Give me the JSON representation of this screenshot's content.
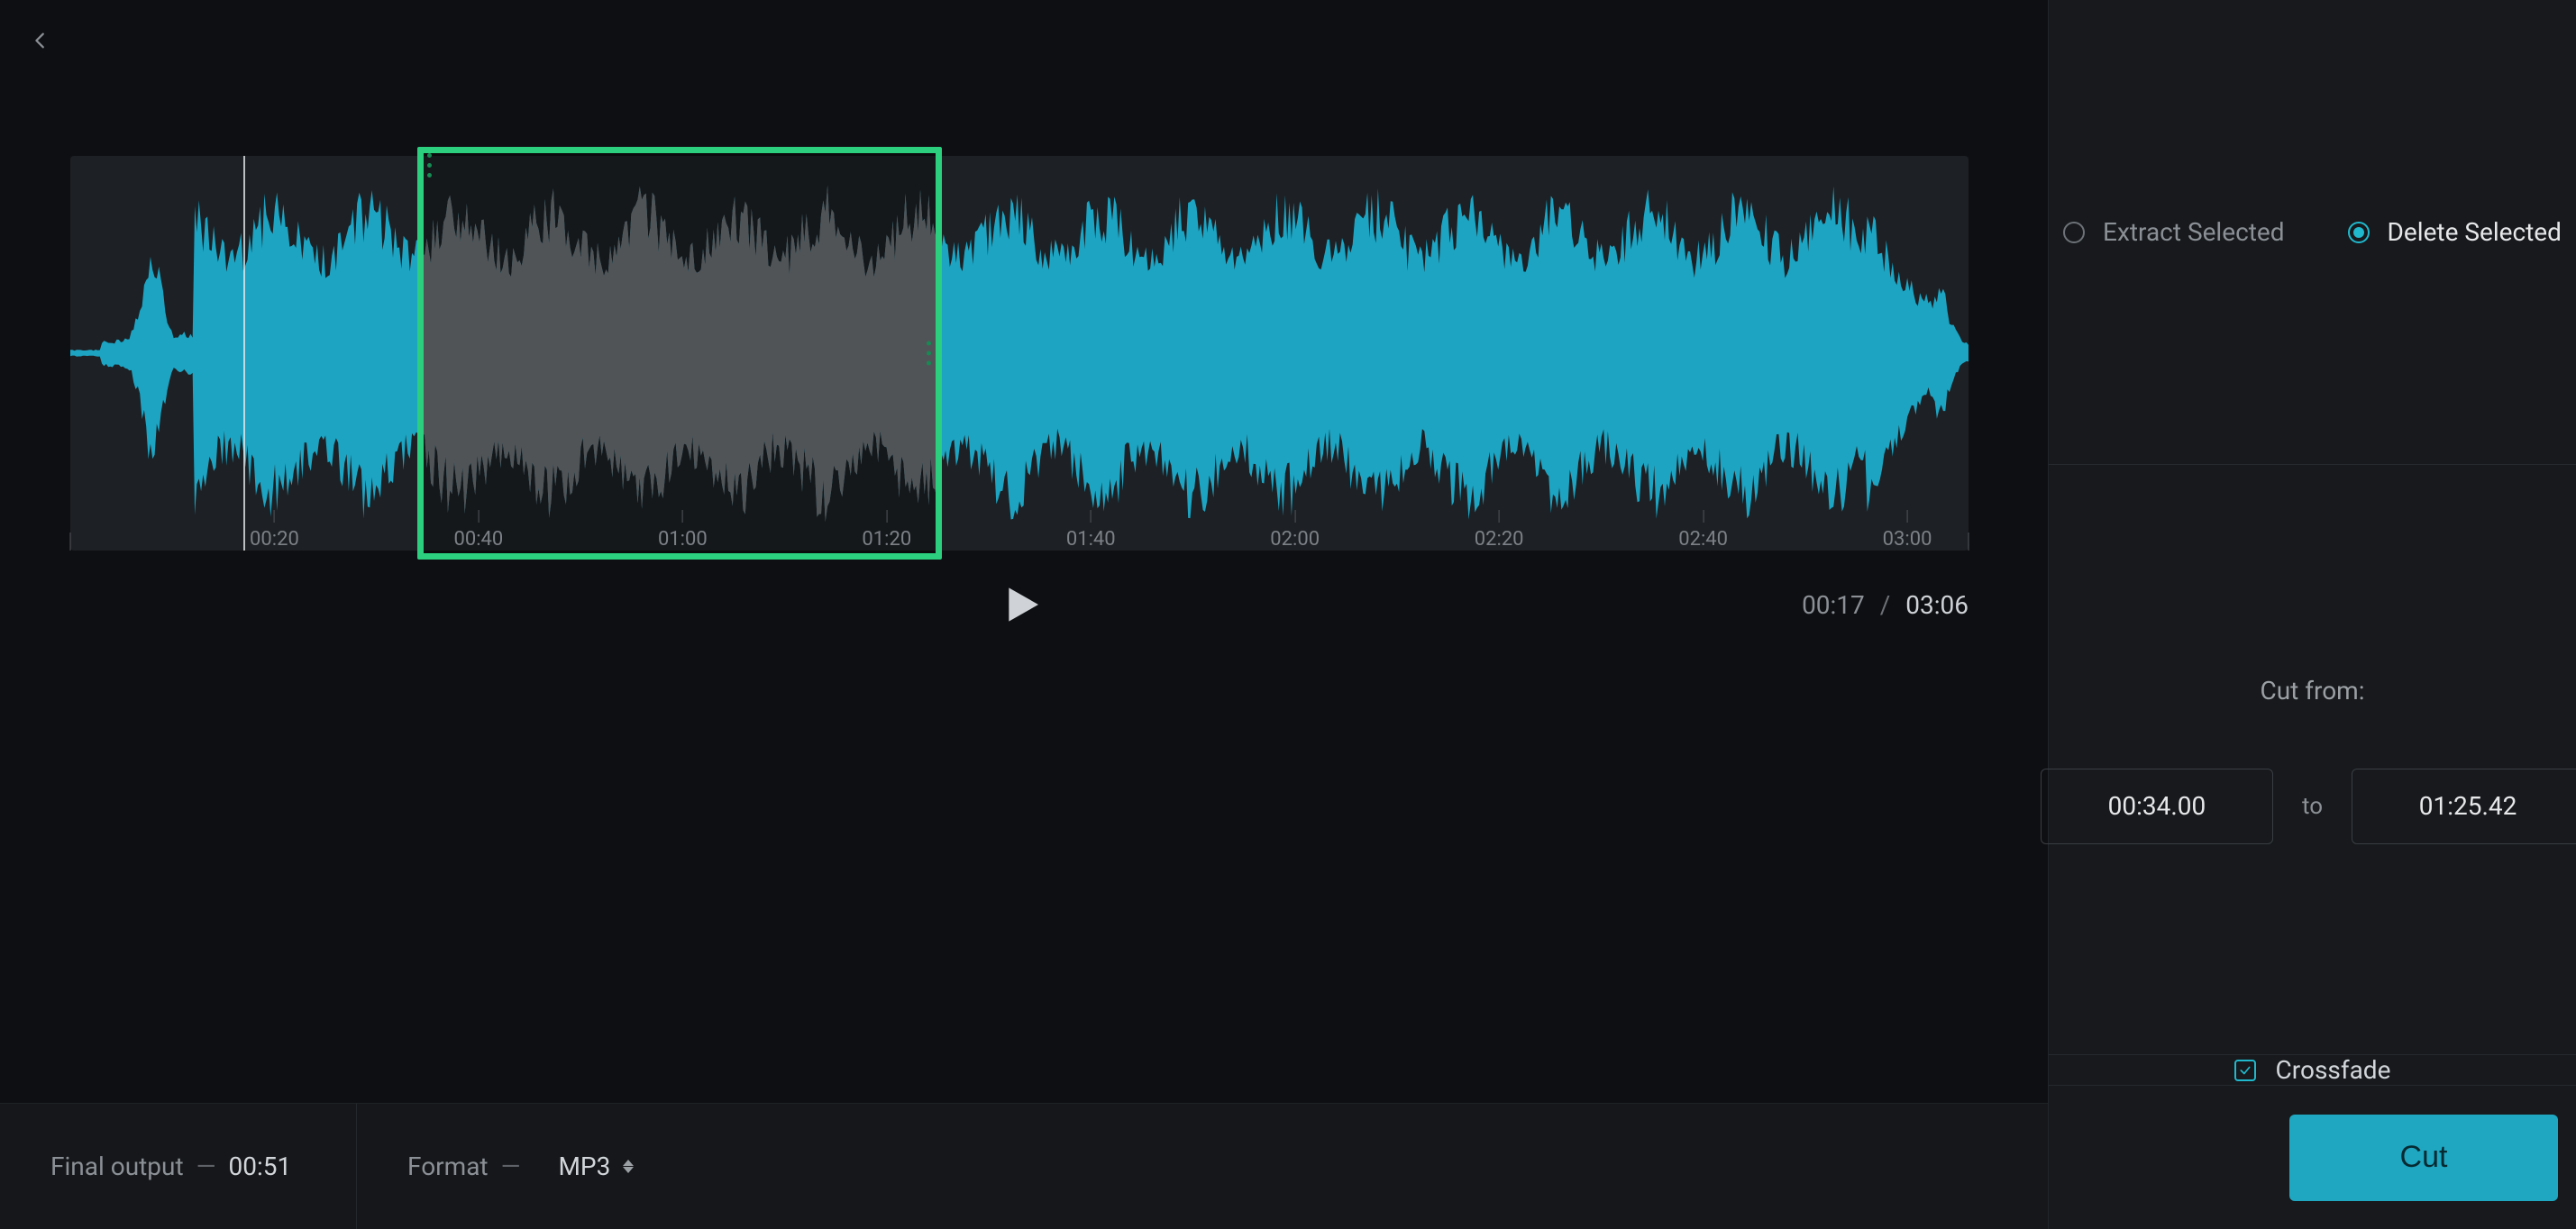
{
  "playback": {
    "current": "00:17",
    "separator": "/",
    "duration": "03:06"
  },
  "selection": {
    "start_sec": 34.0,
    "end_sec": 85.42,
    "track_duration_sec": 186
  },
  "ruler": {
    "ticks": [
      "00:20",
      "00:40",
      "01:00",
      "01:20",
      "01:40",
      "02:00",
      "02:20",
      "02:40",
      "03:00"
    ]
  },
  "footer": {
    "final_output_label": "Final output",
    "final_output_value": "00:51",
    "format_label": "Format",
    "format_value": "MP3"
  },
  "panel": {
    "mode_extract": "Extract Selected",
    "mode_delete": "Delete Selected",
    "mode_selected": "delete",
    "range_label": "Cut from:",
    "range_from": "00:34.00",
    "range_to_label": "to",
    "range_to": "01:25.42",
    "crossfade_label": "Crossfade",
    "crossfade_checked": true,
    "action_label": "Cut"
  },
  "colors": {
    "wave": "#1ca4c2",
    "wave_muted": "#6c7075",
    "selection_border": "#2bcf7e",
    "accent": "#20b8cc"
  }
}
